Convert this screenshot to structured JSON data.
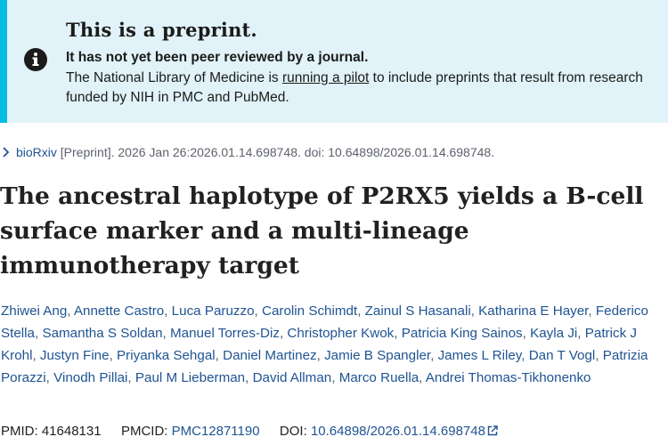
{
  "banner": {
    "title": "This is a preprint.",
    "subtitle": "It has not yet been peer reviewed by a journal.",
    "body_before": "The National Library of Medicine is ",
    "body_link": "running a pilot",
    "body_after": " to include preprints that result from research funded by NIH in PMC and PubMed.",
    "icon": "info-icon",
    "colors": {
      "background": "#e1f3f8",
      "accent": "#00bde3"
    }
  },
  "citation": {
    "source": "bioRxiv",
    "rest": " [Preprint]. 2026 Jan 26:2026.01.14.698748. doi: 10.64898/2026.01.14.698748."
  },
  "article": {
    "title": "The ancestral haplotype of P2RX5 yields a B-cell surface marker and a multi-lineage immunotherapy target"
  },
  "authors": [
    "Zhiwei Ang",
    "Annette Castro",
    "Luca Paruzzo",
    "Carolin Schimdt",
    "Zainul S Hasanali",
    "Katharina E Hayer",
    "Federico Stella",
    "Samantha S Soldan",
    "Manuel Torres-Diz",
    "Christopher Kwok",
    "Patricia King Sainos",
    "Kayla Ji",
    "Patrick J Krohl",
    "Justyn Fine",
    "Priyanka Sehgal",
    "Daniel Martinez",
    "Jamie B Spangler",
    "James L Riley",
    "Dan T Vogl",
    "Patrizia Porazzi",
    "Vinodh Pillai",
    "Paul M Lieberman",
    "David Allman",
    "Marco Ruella",
    "Andrei Thomas-Tikhonenko"
  ],
  "identifiers": {
    "pmid_label": "PMID:",
    "pmid": "41648131",
    "pmcid_label": "PMCID:",
    "pmcid": "PMC12871190",
    "doi_label": "DOI:",
    "doi": "10.64898/2026.01.14.698748"
  },
  "colors": {
    "link": "#205493",
    "text": "#212121"
  }
}
